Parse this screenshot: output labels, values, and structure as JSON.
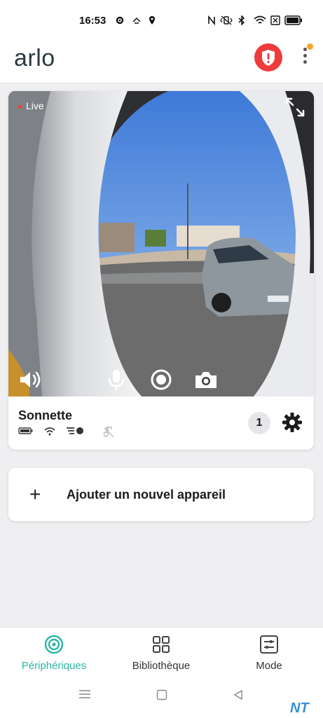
{
  "status_bar": {
    "time": "16:53",
    "left_icons": [
      "gear-icon",
      "cast-icon",
      "location-icon"
    ],
    "right_icons": [
      "nfc-icon",
      "vibrate-icon",
      "bluetooth-icon",
      "wifi-icon",
      "sim-icon",
      "battery-icon"
    ]
  },
  "header": {
    "logo": "arlo",
    "shield_icon": "security-shield-icon",
    "menu_icon": "kebab-menu-icon",
    "colors": {
      "shield": "#ee3b3b",
      "notification_dot": "#f5a623"
    }
  },
  "camera_card": {
    "live_label": "Live",
    "name": "Sonnette",
    "event_count": "1",
    "controls": [
      "speaker-icon",
      "microphone-icon",
      "record-icon",
      "snapshot-icon"
    ],
    "status_icons": [
      "battery-icon",
      "wifi-signal-icon",
      "motion-sensitivity-icon",
      "chime-muted-icon"
    ]
  },
  "add_device": {
    "label": "Ajouter un nouvel appareil"
  },
  "bottom_nav": {
    "items": [
      {
        "label": "Périphériques",
        "icon": "devices-icon",
        "active": true
      },
      {
        "label": "Bibliothèque",
        "icon": "library-grid-icon",
        "active": false
      },
      {
        "label": "Mode",
        "icon": "mode-sliders-icon",
        "active": false
      }
    ],
    "accent": "#2bb5a2"
  },
  "system_nav": [
    "menu-lines-icon",
    "home-square-icon",
    "back-triangle-icon"
  ],
  "watermark": "NT"
}
